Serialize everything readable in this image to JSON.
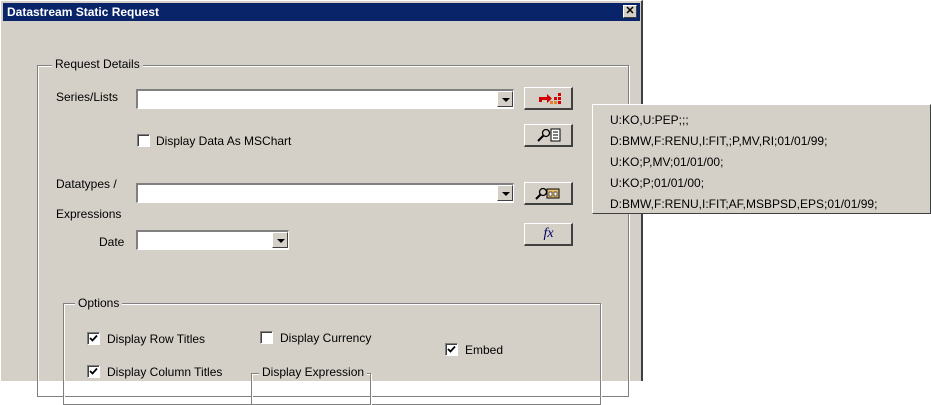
{
  "window": {
    "title": "Datastream Static Request",
    "close_glyph": "✕"
  },
  "request_details": {
    "legend": "Request Details",
    "series_label": "Series/Lists",
    "series_value": "",
    "display_mschart_label": "Display Data As MSChart",
    "display_mschart_checked": false,
    "datatypes_label_1": "Datatypes /",
    "datatypes_label_2": "Expressions",
    "datatypes_value": "",
    "date_label": "Date",
    "date_value": ""
  },
  "buttons": {
    "series_picker_icon": "arrow-grid-icon",
    "series_find_icon": "find-list-icon",
    "datatype_find_icon": "find-datatype-icon",
    "function_icon": "fx-icon",
    "function_label": "fx"
  },
  "options": {
    "legend": "Options",
    "display_row_titles": {
      "label": "Display Row Titles",
      "checked": true
    },
    "display_currency": {
      "label": "Display Currency",
      "checked": false
    },
    "embed": {
      "label": "Embed",
      "checked": true
    },
    "display_column_titles": {
      "label": "Display Column Titles",
      "checked": true
    },
    "display_expression_legend": "Display Expression"
  },
  "history_popup": {
    "items": [
      "U:KO,U:PEP;;;",
      "D:BMW,F:RENU,I:FIT,;P,MV,RI;01/01/99;",
      "U:KO;P,MV;01/01/00;",
      "U:KO;P;01/01/00;",
      "D:BMW,F:RENU,I:FIT;AF,MSBPSD,EPS;01/01/99;"
    ]
  },
  "colors": {
    "titlebar": "#0a246a",
    "face": "#d4d0c8",
    "accent_red": "#d40000"
  }
}
